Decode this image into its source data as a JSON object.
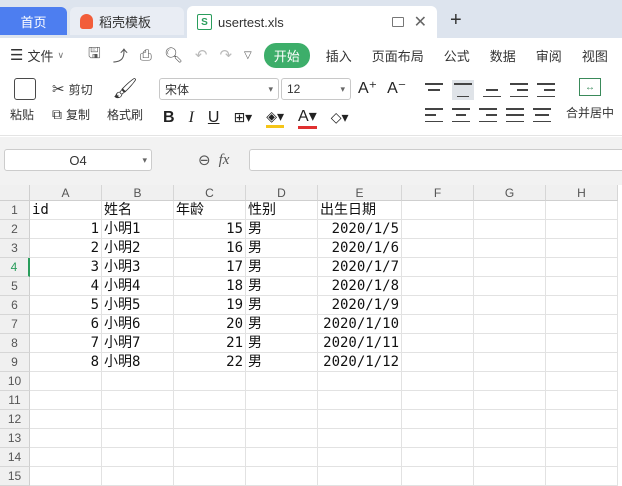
{
  "tabs": {
    "home": "首页",
    "template": "稻壳模板",
    "file": "usertest.xls",
    "new_tab": "+"
  },
  "menubar": {
    "file_menu": "文件",
    "items": [
      "开始",
      "插入",
      "页面布局",
      "公式",
      "数据",
      "审阅",
      "视图"
    ]
  },
  "ribbon": {
    "paste": "粘贴",
    "cut": "剪切",
    "copy": "复制",
    "format_painter": "格式刷",
    "font_name": "宋体",
    "font_size": "12",
    "merge_center": "合并居中"
  },
  "formula_bar": {
    "name_box": "O4",
    "fx": "fx",
    "value": ""
  },
  "sheet": {
    "columns": [
      "A",
      "B",
      "C",
      "D",
      "E",
      "F",
      "G",
      "H"
    ],
    "row_numbers": [
      "1",
      "2",
      "3",
      "4",
      "5",
      "6",
      "7",
      "8",
      "9",
      "10",
      "11",
      "12",
      "13",
      "14",
      "15"
    ],
    "active_row": "4",
    "header": [
      "id",
      "姓名",
      "年龄",
      "性别",
      "出生日期"
    ],
    "rows": [
      [
        "1",
        "小明1",
        "15",
        "男",
        "2020/1/5"
      ],
      [
        "2",
        "小明2",
        "16",
        "男",
        "2020/1/6"
      ],
      [
        "3",
        "小明3",
        "17",
        "男",
        "2020/1/7"
      ],
      [
        "4",
        "小明4",
        "18",
        "男",
        "2020/1/8"
      ],
      [
        "5",
        "小明5",
        "19",
        "男",
        "2020/1/9"
      ],
      [
        "6",
        "小明6",
        "20",
        "男",
        "2020/1/10"
      ],
      [
        "7",
        "小明7",
        "21",
        "男",
        "2020/1/11"
      ],
      [
        "8",
        "小明8",
        "22",
        "男",
        "2020/1/12"
      ]
    ]
  },
  "colors": {
    "accent_blue": "#4d7ef0",
    "accent_green": "#3dae6a"
  }
}
